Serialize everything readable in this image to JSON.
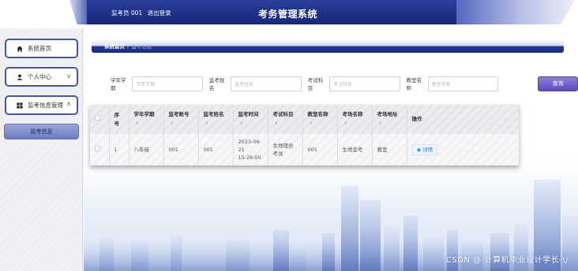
{
  "header": {
    "user_label": "监考员 001",
    "logout_label": "退出登录",
    "app_title": "考务管理系统"
  },
  "sidebar": {
    "items": [
      {
        "label": "系统首页",
        "icon": "home-icon"
      },
      {
        "label": "个人中心",
        "icon": "person-icon",
        "chevron": "∨"
      },
      {
        "label": "监考信息管理",
        "icon": "grid-icon",
        "chevron": "∧"
      }
    ],
    "sub_items": [
      {
        "label": "监考信息"
      }
    ]
  },
  "breadcrumb": {
    "home": "系统首页",
    "sep": "/",
    "current": "监考信息"
  },
  "search": {
    "fields": [
      {
        "label": "学年学期",
        "placeholder": "学年学期"
      },
      {
        "label": "监考姓名",
        "placeholder": "监考姓名"
      },
      {
        "label": "考试科目",
        "placeholder": "考试科目"
      },
      {
        "label": "教室名称",
        "placeholder": "教室名称"
      }
    ],
    "button_label": "查询"
  },
  "table": {
    "columns": [
      "",
      "序号",
      "学年学期",
      "监考账号",
      "监考姓名",
      "监考时间",
      "考试科目",
      "教室名称",
      "考场名称",
      "考场地址",
      "操作"
    ],
    "rows": [
      {
        "index": "1",
        "term": "八年级",
        "account": "001",
        "name": "001",
        "time": "2023-06-21 15:26:50",
        "subject": "生地理合考试",
        "classroom": "001",
        "exam_room": "生地会考",
        "address": "教室",
        "action": "详情"
      }
    ]
  },
  "watermark": "CSDN @-计算机毕业设计学长-\\/",
  "colors": {
    "header_blue": "#1e2f86",
    "menu_border": "#4356a8",
    "search_button": "#5e4fb9",
    "detail_text": "#3b7de0"
  }
}
